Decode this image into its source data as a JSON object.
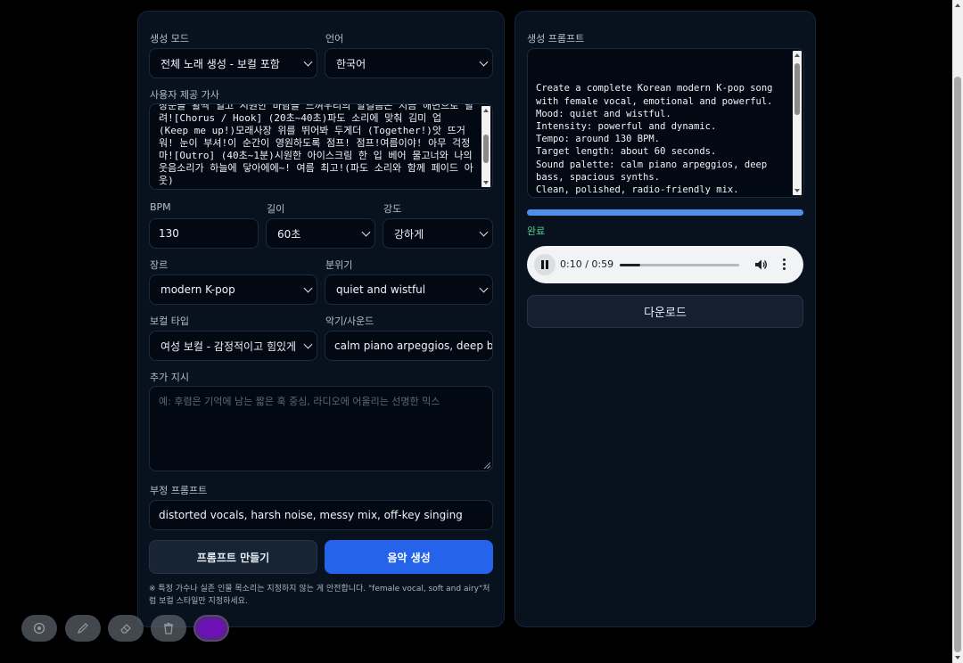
{
  "form": {
    "mode": {
      "label": "생성 모드",
      "value": "전체 노래 생성 - 보컬 포함"
    },
    "language": {
      "label": "언어",
      "value": "한국어"
    },
    "lyrics": {
      "label": "사용자 제공 가사",
      "text": "창문을 활짝 열고 시원한 바람을 느껴우리의 말걸음은 지금 해변으로 달려![Chorus / Hook] (20초~40초)파도 소리에 맞춰 김미 업 (Keep me up!)모래사장 위를 뛰어봐 두게더 (Together!)앗 뜨거워! 눈이 부셔!이 순간이 영원하도록 점프! 점프!여름이야! 아무 걱정 마![Outro] (40초~1분)시원한 아이스크림 한 입 베어 물고너와 나의 웃음소리가 하늘에 닿아에에~! 여름 최고!(파도 소리와 함께 페이드 아웃)"
    },
    "bpm": {
      "label": "BPM",
      "value": "130"
    },
    "length": {
      "label": "길이",
      "value": "60초"
    },
    "intensity": {
      "label": "강도",
      "value": "강하게"
    },
    "genre": {
      "label": "장르",
      "value": "modern K-pop"
    },
    "mood": {
      "label": "분위기",
      "value": "quiet and wistful"
    },
    "vocal": {
      "label": "보컬 타입",
      "value": "여성 보컬 - 감정적이고 힘있게"
    },
    "instruments": {
      "label": "악기/사운드",
      "value": "calm piano arpeggios, deep bass"
    },
    "extra": {
      "label": "추가 지시",
      "placeholder": "예: 후렴은 기억에 남는 짧은 훅 중심, 라디오에 어울리는 선명한 믹스"
    },
    "negative": {
      "label": "부정 프롬프트",
      "value": "distorted vocals, harsh noise, messy mix, off-key singing"
    },
    "make_prompt_label": "프롬프트 만들기",
    "generate_label": "음악 생성",
    "note": "※ 특정 가수나 실존 인물 목소리는 지정하지 않는 게 안전합니다. \"female vocal, soft and airy\"처럼 보컬 스타일만 지정하세요."
  },
  "output": {
    "prompt_label": "생성 프롬프트",
    "prompt_text": "Create a complete Korean modern K-pop song\nwith female vocal, emotional and powerful.\nMood: quiet and wistful.\nIntensity: powerful and dynamic.\nTempo: around 130 BPM.\nTarget length: about 60 seconds.\nSound palette: calm piano arpeggios, deep\nbass, spacious synths.\nClean, polished, radio-friendly mix.\n\nUse the following lyrics as closely as",
    "progress": 1.0,
    "status": "완료",
    "audio": {
      "current": "0:10",
      "duration": "0:59",
      "position": 0.17
    },
    "download_label": "다운로드"
  },
  "toolbar": {
    "tools": [
      "eye-icon",
      "pencil-icon",
      "eraser-icon",
      "trash-icon",
      "color-swatch"
    ],
    "color": "#6b11b5"
  },
  "colors": {
    "background": "#000000",
    "panel": "#08121f",
    "accent": "#2563eb",
    "progress": "#4f8fe8",
    "success": "#52d08a"
  }
}
